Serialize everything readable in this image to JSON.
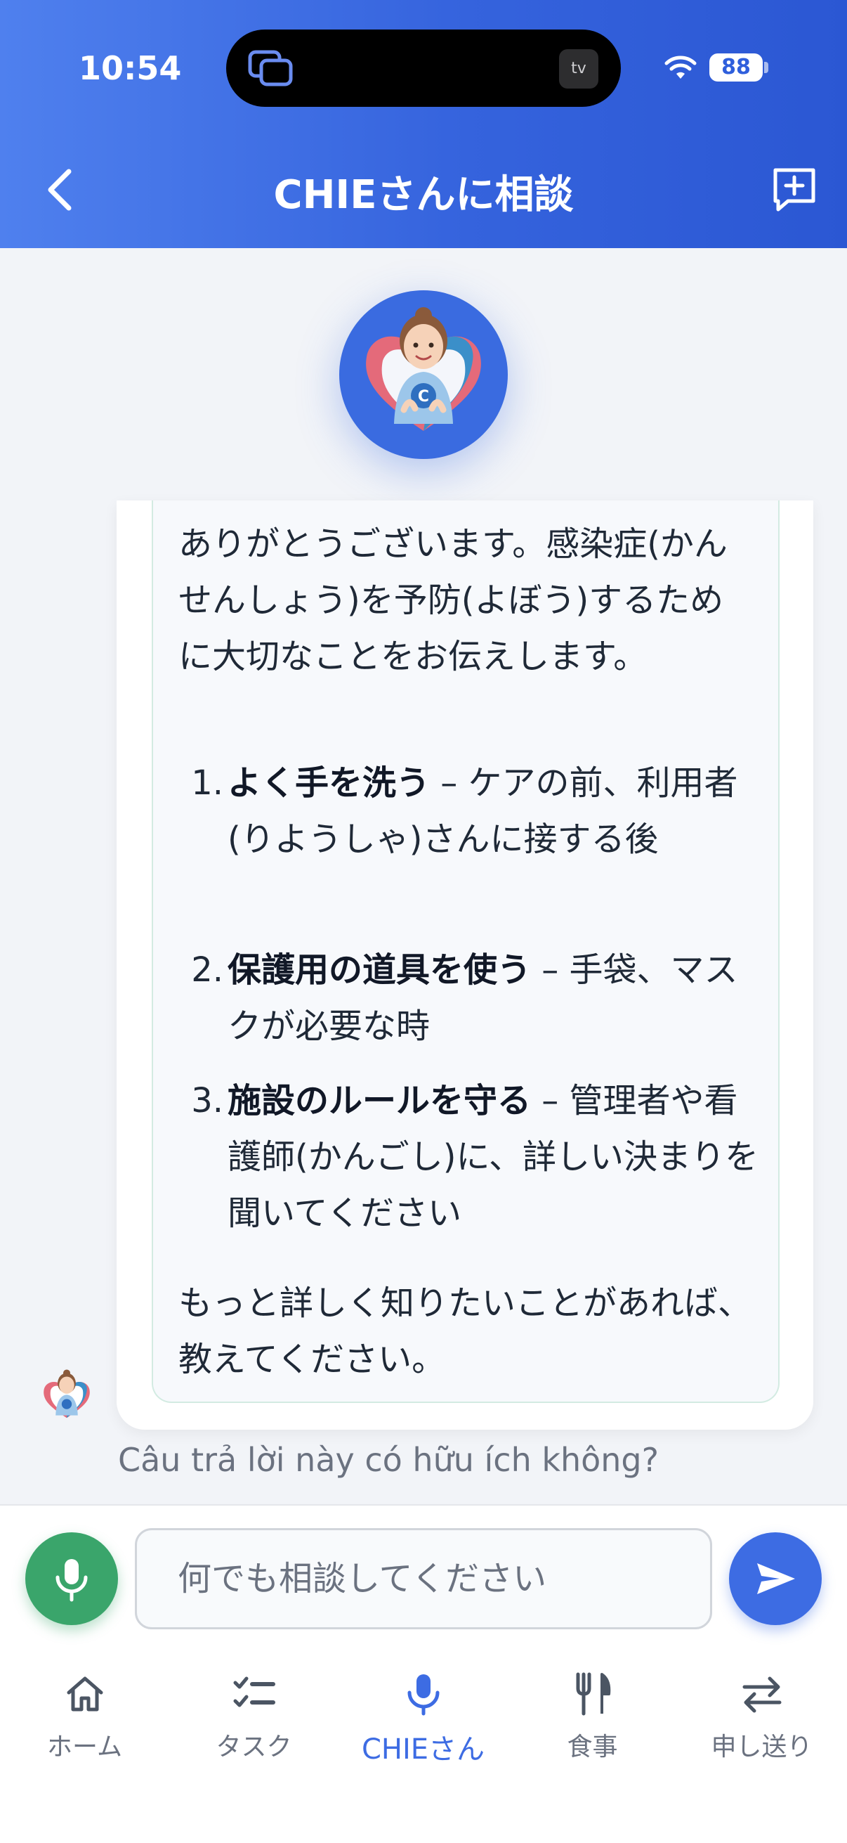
{
  "status_bar": {
    "time": "10:54",
    "battery": "88",
    "island_badge": "tv"
  },
  "header": {
    "title": "CHIEさんに相談"
  },
  "message": {
    "intro": "ありがとうございます。感染症(かんせんしょう)を予防(よぼう)するために大切なことをお伝えします。",
    "items": [
      {
        "num": "1.",
        "title": "よく手を洗う",
        "text": " – ケアの前、利用者(りようしゃ)さんに接する後"
      },
      {
        "num": "2.",
        "title": "保護用の道具を使う",
        "text": " – 手袋、マスクが必要な時"
      },
      {
        "num": "3.",
        "title": "施設のルールを守る",
        "text": " – 管理者や看護師(かんごし)に、詳しい決まりを聞いてください"
      }
    ],
    "outro": "もっと詳しく知りたいことがあれば、教えてください。"
  },
  "feedback": {
    "question": "Câu trả lời này có hữu ích không?"
  },
  "input": {
    "placeholder": "何でも相談してください"
  },
  "nav": {
    "items": [
      {
        "label": "ホーム",
        "icon": "home-icon"
      },
      {
        "label": "タスク",
        "icon": "task-checklist-icon"
      },
      {
        "label": "CHIEさん",
        "icon": "microphone-icon",
        "active": true
      },
      {
        "label": "食事",
        "icon": "fork-knife-icon"
      },
      {
        "label": "申し送り",
        "icon": "swap-arrows-icon"
      }
    ]
  },
  "colors": {
    "header_gradient_start": "#4f80ee",
    "header_gradient_end": "#2b57d3",
    "accent": "#3d6ce3",
    "mic_green": "#3aa56b"
  }
}
